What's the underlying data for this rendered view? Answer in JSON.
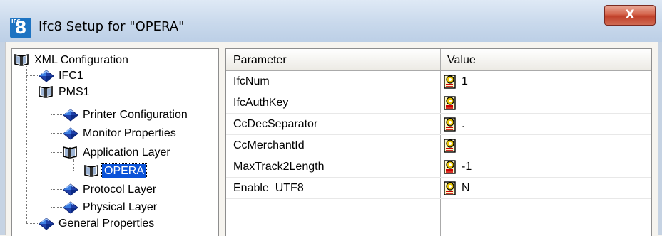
{
  "window": {
    "title": "Ifc8 Setup for \"OPERA\"",
    "app_icon_text": "8",
    "app_icon_small": "IFC",
    "close_label": "X"
  },
  "tree": {
    "items": [
      {
        "label": "XML Configuration",
        "icon": "book-open-icon",
        "level": 0
      },
      {
        "label": "IFC1",
        "icon": "blue-diamond-icon",
        "level": 1
      },
      {
        "label": "PMS1",
        "icon": "book-open-icon",
        "level": 1
      },
      {
        "label": "Printer Configuration",
        "icon": "blue-diamond-icon",
        "level": 2
      },
      {
        "label": "Monitor Properties",
        "icon": "blue-diamond-icon",
        "level": 2
      },
      {
        "label": "Application Layer",
        "icon": "book-open-icon",
        "level": 2
      },
      {
        "label": "OPERA",
        "icon": "book-open-icon",
        "level": 3,
        "selected": true
      },
      {
        "label": "Protocol Layer",
        "icon": "blue-diamond-icon",
        "level": 2
      },
      {
        "label": "Physical Layer",
        "icon": "blue-diamond-icon",
        "level": 2
      },
      {
        "label": "General Properties",
        "icon": "blue-diamond-icon",
        "level": 1
      }
    ]
  },
  "grid": {
    "headers": {
      "parameter": "Parameter",
      "value": "Value"
    },
    "rows": [
      {
        "parameter": "IfcNum",
        "value": "1"
      },
      {
        "parameter": "IfcAuthKey",
        "value": ""
      },
      {
        "parameter": "CcDecSeparator",
        "value": "."
      },
      {
        "parameter": "CcMerchantId",
        "value": ""
      },
      {
        "parameter": "MaxTrack2Length",
        "value": "-1"
      },
      {
        "parameter": "Enable_UTF8",
        "value": "N"
      }
    ],
    "row_icon": "edit-pencil-icon"
  },
  "colors": {
    "selection": "#0a52d8",
    "close_button": "#c84a33",
    "titlebar": "#c9d9ec"
  }
}
